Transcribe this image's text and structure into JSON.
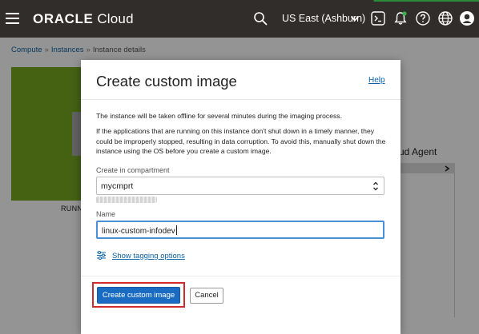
{
  "header": {
    "logo_primary": "ORACLE",
    "logo_secondary": "Cloud",
    "region": "US East (Ashburn)",
    "icons": [
      "menu-icon",
      "search-icon",
      "chevron-down-icon",
      "terminal-icon",
      "bell-icon",
      "help-icon",
      "globe-icon",
      "user-icon"
    ]
  },
  "breadcrumb": {
    "items": [
      "Compute",
      "Instances",
      "Instance details"
    ],
    "separator": "»"
  },
  "background": {
    "status_label": "RUNNING",
    "status_label_visible": "RUNN",
    "status_color": "#76a920",
    "side_text": "ud Agent"
  },
  "modal": {
    "title": "Create custom image",
    "help_label": "Help",
    "paragraph1": "The instance will be taken offline for several minutes during the imaging process.",
    "paragraph2": "If the applications that are running on this instance don't shut down in a timely manner, they could be improperly stopped, resulting in data corruption. To avoid this, manually shut down the instance using the OS before you create a custom image.",
    "compartment_label": "Create in compartment",
    "compartment_value": "mycmprt",
    "name_label": "Name",
    "name_value": "linux-custom-infodev",
    "tagging_link": "Show tagging options",
    "create_button": "Create custom image",
    "cancel_button": "Cancel",
    "highlight_color": "#d02a2a",
    "primary_color": "#1a6cc2"
  }
}
